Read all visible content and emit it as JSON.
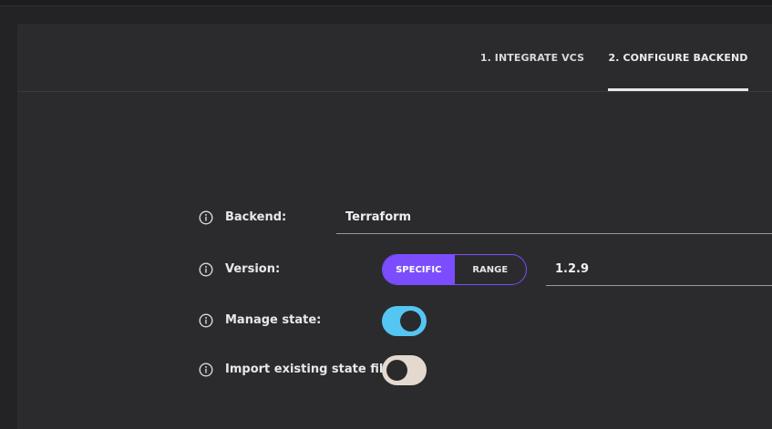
{
  "tabs": [
    {
      "label": "1. INTEGRATE VCS",
      "active": false
    },
    {
      "label": "2. CONFIGURE BACKEND",
      "active": true
    }
  ],
  "form": {
    "backend": {
      "label": "Backend:",
      "value": "Terraform"
    },
    "version": {
      "label": "Version:",
      "mode_options": [
        "SPECIFIC",
        "RANGE"
      ],
      "selected_mode": "SPECIFIC",
      "value": "1.2.9"
    },
    "manage_state": {
      "label": "Manage state:",
      "enabled": true
    },
    "import_state": {
      "label": "Import existing state file:",
      "enabled": false
    }
  },
  "icons": {
    "info": "info-circle-icon"
  },
  "colors": {
    "accent_purple": "#7c4dff",
    "toggle_on": "#55c6f2",
    "toggle_off": "#e3d9cf"
  }
}
